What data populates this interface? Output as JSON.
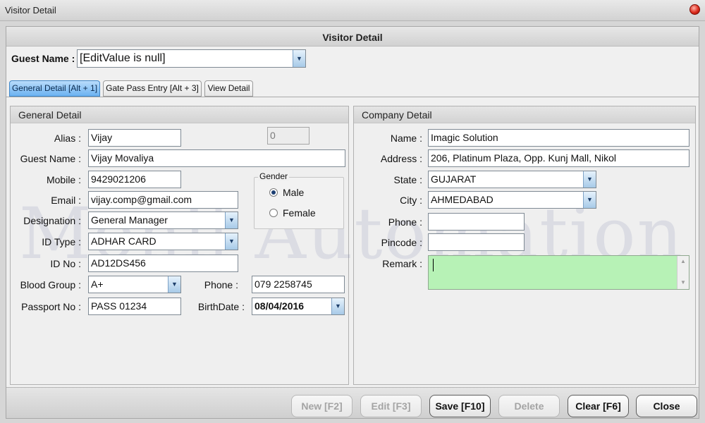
{
  "window": {
    "title": "Visitor Detail"
  },
  "header": {
    "title": "Visitor Detail"
  },
  "guest_name": {
    "label": "Guest Name :",
    "value": "[EditValue is null]"
  },
  "tabs": [
    {
      "label": "General Detail [Alt + 1]"
    },
    {
      "label": "Gate Pass Entry [Alt + 3]"
    },
    {
      "label": "View Detail"
    }
  ],
  "general": {
    "title": "General Detail",
    "alias": {
      "label": "Alias :",
      "value": "Vijay"
    },
    "id_counter": {
      "value": "0"
    },
    "guest_name": {
      "label": "Guest Name :",
      "value": "Vijay Movaliya"
    },
    "mobile": {
      "label": "Mobile :",
      "value": "9429021206"
    },
    "gender": {
      "label": "Gender",
      "male": "Male",
      "female": "Female",
      "selected": "Male"
    },
    "email": {
      "label": "Email :",
      "value": "vijay.comp@gmail.com"
    },
    "designation": {
      "label": "Designation :",
      "value": "General Manager"
    },
    "id_type": {
      "label": "ID Type :",
      "value": "ADHAR CARD"
    },
    "id_no": {
      "label": "ID No :",
      "value": "AD12DS456"
    },
    "blood_group": {
      "label": "Blood Group :",
      "value": "A+"
    },
    "phone": {
      "label": "Phone :",
      "value": "079 2258745"
    },
    "passport": {
      "label": "Passport No :",
      "value": "PASS 01234"
    },
    "birthdate": {
      "label": "BirthDate :",
      "value": "08/04/2016"
    }
  },
  "company": {
    "title": "Company Detail",
    "name": {
      "label": "Name :",
      "value": "Imagic Solution"
    },
    "address": {
      "label": "Address :",
      "value": "206, Platinum Plaza, Opp. Kunj Mall, Nikol"
    },
    "state": {
      "label": "State :",
      "value": "GUJARAT"
    },
    "city": {
      "label": "City :",
      "value": "AHMEDABAD"
    },
    "phone": {
      "label": "Phone :",
      "value": ""
    },
    "pincode": {
      "label": "Pincode :",
      "value": ""
    },
    "remark": {
      "label": "Remark :",
      "value": ""
    }
  },
  "footer": {
    "new_label": "New [F2]",
    "edit_label": "Edit [F3]",
    "save_label": "Save [F10]",
    "delete_label": "Delete",
    "clear_label": "Clear [F6]",
    "close_label": "Close"
  },
  "watermark": "Monil Automation",
  "colors": {
    "active_tab": "#6cb2f1",
    "remark_bg": "#b7f2b6",
    "close_dot": "#dc2b1c"
  },
  "icons": {
    "dropdown": "chevron-down-icon",
    "close": "close-icon"
  }
}
